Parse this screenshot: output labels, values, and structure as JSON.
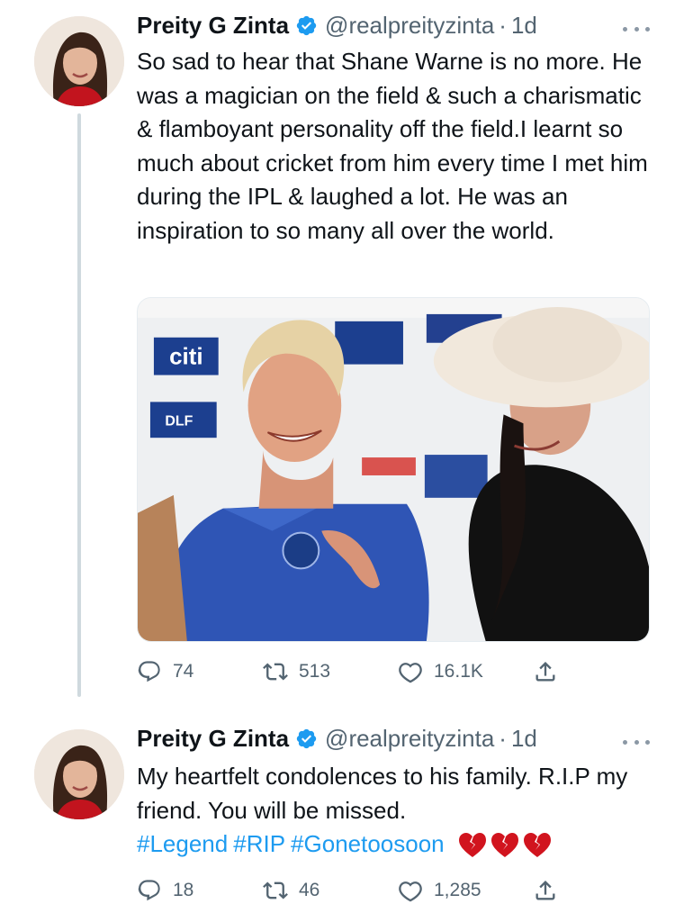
{
  "tweets": [
    {
      "author_name": "Preity G Zinta",
      "handle": "@realpreityzinta",
      "separator": "·",
      "time": "1d",
      "text": "So sad to hear that Shane Warne is no more. He was a magician on the field & such a charismatic & flamboyant personality off the field.I learnt so much about cricket from him every time I met him during the IPL & laughed a lot. He was an inspiration to so many all over the world.",
      "replies": "74",
      "retweets": "513",
      "likes": "16.1K"
    },
    {
      "author_name": "Preity G Zinta",
      "handle": "@realpreityzinta",
      "separator": "·",
      "time": "1d",
      "text": "My heartfelt condolences to his family. R.I.P my friend. You will be missed.",
      "hashtags": [
        "#Legend",
        "#RIP",
        "#Gonetoosoon"
      ],
      "emoji": [
        "broken-heart",
        "broken-heart",
        "broken-heart"
      ],
      "replies": "18",
      "retweets": "46",
      "likes": "1,285"
    }
  ],
  "media_backdrop_text": [
    "citi",
    "DLF"
  ],
  "icons": {
    "verified": "verified-badge-icon",
    "more": "more-options-icon",
    "reply": "reply-icon",
    "retweet": "retweet-icon",
    "like": "like-icon",
    "share": "share-icon"
  },
  "colors": {
    "accent": "#1d9bf0",
    "secondary_text": "#536471",
    "thread_line": "#cfd9de",
    "broken_heart": "#d1141e"
  }
}
